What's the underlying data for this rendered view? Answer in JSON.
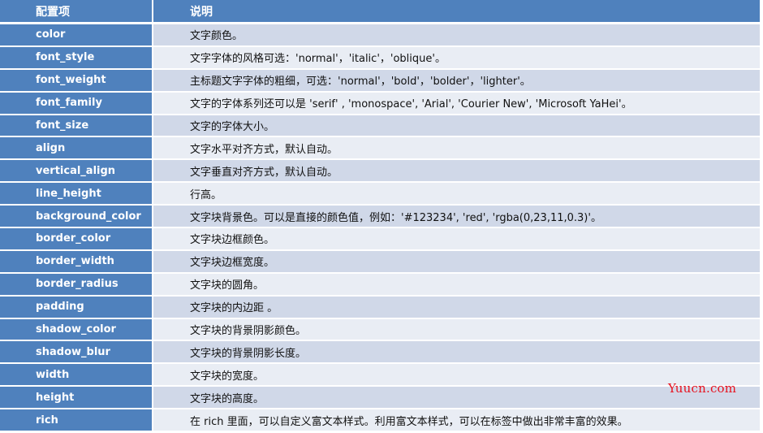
{
  "table": {
    "headers": {
      "key": "配置项",
      "desc": "说明"
    },
    "rows": [
      {
        "key": "color",
        "desc": "文字颜色。"
      },
      {
        "key": "font_style",
        "desc": "文字字体的风格可选：'normal'，'italic'，'oblique'。"
      },
      {
        "key": "font_weight",
        "desc": "主标题文字字体的粗细，可选：'normal'，'bold'，'bolder'，'lighter'。"
      },
      {
        "key": "font_family",
        "desc": "文字的字体系列还可以是 'serif' , 'monospace', 'Arial', 'Courier New', 'Microsoft YaHei'。"
      },
      {
        "key": "font_size",
        "desc": "文字的字体大小。"
      },
      {
        "key": "align",
        "desc": "文字水平对齐方式，默认自动。"
      },
      {
        "key": "vertical_align",
        "desc": "文字垂直对齐方式，默认自动。"
      },
      {
        "key": "line_height",
        "desc": "行高。"
      },
      {
        "key": "background_color",
        "desc": "文字块背景色。可以是直接的颜色值，例如：'#123234', 'red', 'rgba(0,23,11,0.3)'。"
      },
      {
        "key": "border_color",
        "desc": "文字块边框颜色。"
      },
      {
        "key": "border_width",
        "desc": "文字块边框宽度。"
      },
      {
        "key": "border_radius",
        "desc": "文字块的圆角。"
      },
      {
        "key": "padding",
        "desc": "文字块的内边距 。"
      },
      {
        "key": "shadow_color",
        "desc": "文字块的背景阴影颜色。"
      },
      {
        "key": "shadow_blur",
        "desc": "文字块的背景阴影长度。"
      },
      {
        "key": "width",
        "desc": "文字块的宽度。"
      },
      {
        "key": "height",
        "desc": "文字块的高度。"
      },
      {
        "key": "rich",
        "desc": "在 rich 里面，可以自定义富文本样式。利用富文本样式，可以在标签中做出非常丰富的效果。"
      }
    ]
  },
  "watermark": "Yuucn.com",
  "colors": {
    "header_bg": "#4f81bd",
    "row_odd_bg": "#d0d8e8",
    "row_even_bg": "#e9edf4",
    "watermark": "#e8121e"
  }
}
